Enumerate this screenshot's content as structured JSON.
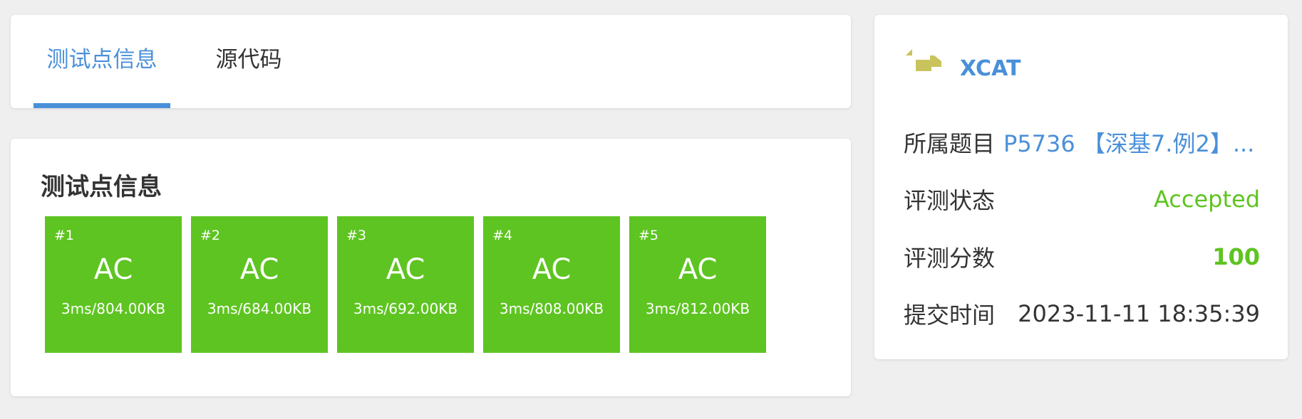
{
  "tabs": [
    {
      "label": "测试点信息",
      "active": true
    },
    {
      "label": "源代码",
      "active": false
    }
  ],
  "testpoints": {
    "title": "测试点信息",
    "items": [
      {
        "index": "#1",
        "status": "AC",
        "usage": "3ms/804.00KB"
      },
      {
        "index": "#2",
        "status": "AC",
        "usage": "3ms/684.00KB"
      },
      {
        "index": "#3",
        "status": "AC",
        "usage": "3ms/692.00KB"
      },
      {
        "index": "#4",
        "status": "AC",
        "usage": "3ms/808.00KB"
      },
      {
        "index": "#5",
        "status": "AC",
        "usage": "3ms/812.00KB"
      }
    ]
  },
  "info": {
    "user": {
      "name": "XCAT",
      "avatar": "user-avatar-icon"
    },
    "problem": {
      "label": "所属题目",
      "value": "P5736 【深基7.例2】..."
    },
    "status": {
      "label": "评测状态",
      "value": "Accepted"
    },
    "score": {
      "label": "评测分数",
      "value": "100"
    },
    "time": {
      "label": "提交时间",
      "value": "2023-11-11 18:35:39"
    }
  },
  "colors": {
    "accent": "#4a90d9",
    "accepted": "#5ec421",
    "background": "#efefef",
    "avatar": "#c9c35d"
  }
}
